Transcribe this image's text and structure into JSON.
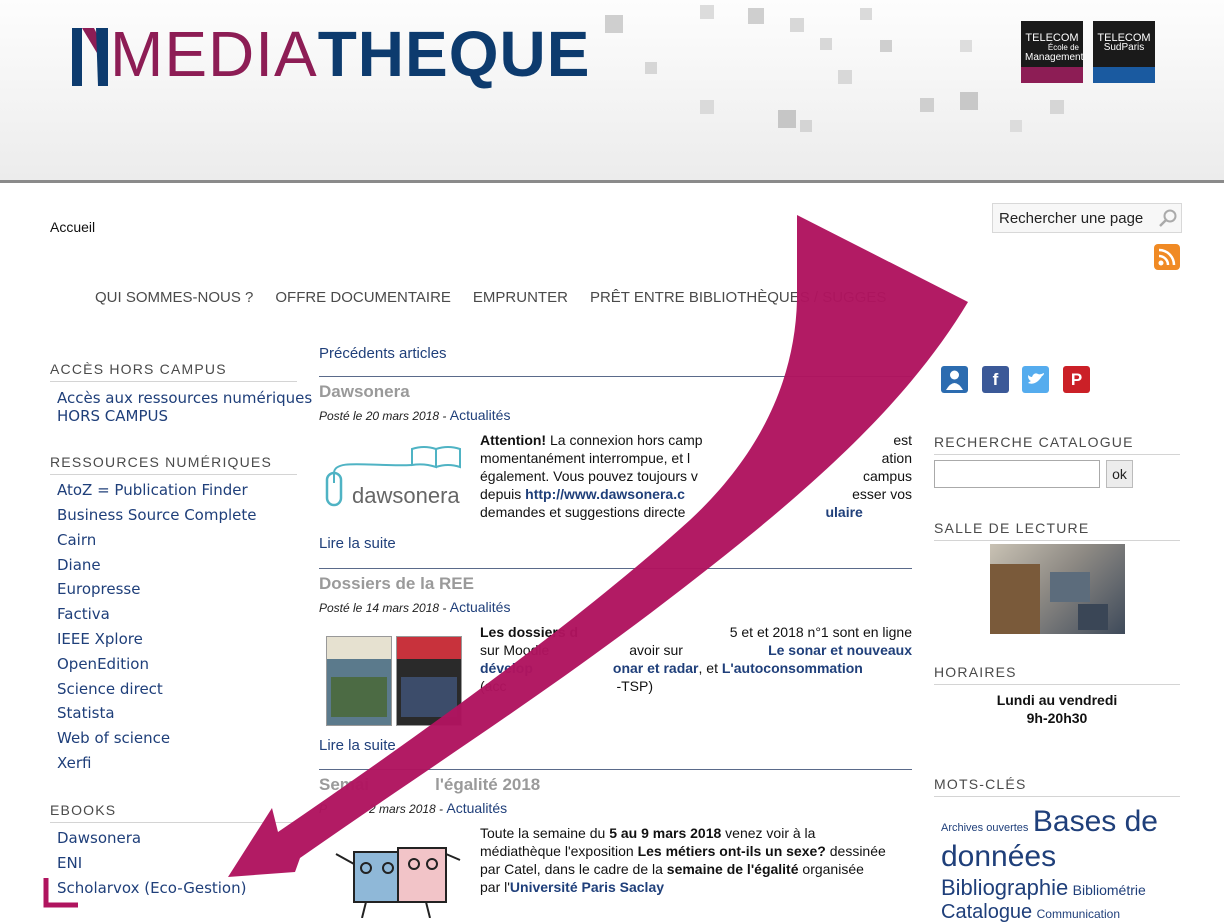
{
  "header": {
    "logo_part1": "MEDIA",
    "logo_part2": "THEQUE",
    "logo_mark": "M",
    "partner1_line1": "TELECOM",
    "partner1_line2": "École de",
    "partner1_line3": "Management",
    "partner2_line1": "TELECOM",
    "partner2_line2": "SudParis"
  },
  "breadcrumb": "Accueil",
  "search": {
    "placeholder": "Rechercher une page"
  },
  "menu": [
    "QUI SOMMES-NOUS ?",
    "OFFRE DOCUMENTAIRE",
    "EMPRUNTER",
    "PRÊT ENTRE BIBLIOTHÈQUES / SUGGES"
  ],
  "left": {
    "sec1": "ACCÈS HORS CAMPUS",
    "sec1_link_line1": "Accès aux ressources numériques",
    "sec1_link_line2": "HORS CAMPUS",
    "sec2": "RESSOURCES NUMÉRIQUES",
    "sec2_links": [
      "AtoZ = Publication Finder",
      "Business Source Complete",
      "Cairn",
      "Diane",
      "Europresse",
      "Factiva",
      "IEEE Xplore",
      "OpenEdition",
      "Science direct",
      "Statista",
      "Web of science",
      "Xerfi"
    ],
    "sec3": "EBOOKS",
    "sec3_links": [
      "Dawsonera",
      "ENI",
      "Scholarvox (Eco-Gestion)"
    ]
  },
  "main": {
    "prev": "Précédents articles",
    "read_more": "Lire la suite",
    "art1": {
      "title": "Dawsonera",
      "meta": "Posté le 20 mars 2018 -",
      "cat": "Actualités",
      "logo": "dawsonera",
      "b1": "Attention!",
      "t1": " La connexion hors camp",
      "t2": "est",
      "t3": "momentanément interrompue, et l",
      "t4": "ation",
      "t5": "également. Vous pouvez toujours v",
      "t6": "campus",
      "t7": "depuis ",
      "link1": "http://www.dawsonera.c",
      "t8": "esser vos",
      "t9": "demandes et suggestions directe",
      "link2": "ulaire"
    },
    "art2": {
      "title": "Dossiers de la REE",
      "meta": "Posté le 14 mars 2018 -",
      "cat": "Actualités",
      "b1": "Les dossiers d",
      "t1": "5 et et 2018 n°1 sont en ligne",
      "t2": "sur Moodle",
      "t3": "avoir sur ",
      "link1": "Le sonar et nouveaux",
      "link2": "dévelop",
      "link3": "onar et radar",
      "t4": ", et ",
      "link4": "L'autoconsommation",
      "t5": "(acc",
      "t6": "-TSP)"
    },
    "art3": {
      "title_a": "Semai",
      "title_b": "l'égalité 2018",
      "meta_a": "P",
      "meta_b": "2 mars 2018 -",
      "cat": "Actualités",
      "t1": "Toute la semaine du ",
      "b1": "5 au 9 mars 2018",
      "t2": " venez voir à la",
      "t3": "médiathèque l'exposition ",
      "b2": "Les métiers ont-ils un sexe?",
      "t4": " dessinée",
      "t5": "par Catel, dans le cadre de la ",
      "b3": "semaine de l'égalité",
      "t6": " organisée",
      "t7": "par l'",
      "link1": "Université Paris Saclay"
    }
  },
  "right": {
    "social": [
      "person-icon",
      "facebook-icon",
      "twitter-icon",
      "pinterest-icon"
    ],
    "sec_catalog": "RECHERCHE CATALOGUE",
    "catalog_button": "ok",
    "sec_reading": "SALLE DE LECTURE",
    "sec_hours": "HORAIRES",
    "hours_line1": "Lundi au vendredi",
    "hours_line2": "9h-20h30",
    "sec_tags": "MOTS-CLÉS",
    "tags": [
      "Archives ouvertes",
      "Bases de",
      "données",
      "Bibliographie",
      "Bibliométrie",
      "Catalogue",
      "Communication"
    ]
  },
  "colors": {
    "annotation": "#b0145f",
    "brand_purple": "#8d1d55",
    "brand_blue": "#0d3b6e",
    "link": "#1f3f7a"
  }
}
